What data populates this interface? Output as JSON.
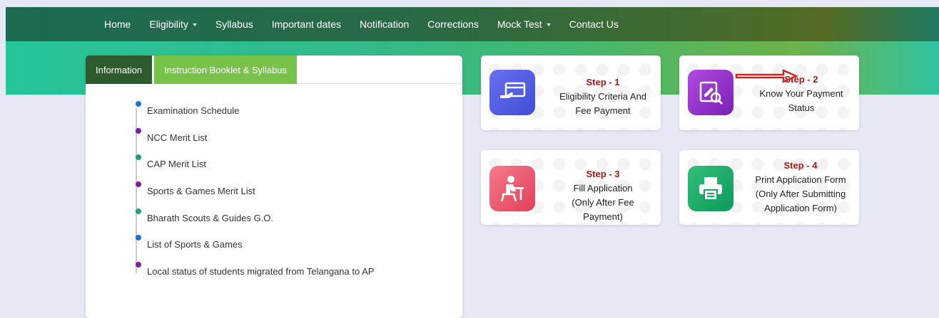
{
  "nav": {
    "home": "Home",
    "eligibility": "Eligibility",
    "syllabus": "Syllabus",
    "important_dates": "Important dates",
    "notification": "Notification",
    "corrections": "Corrections",
    "mock_test": "Mock Test",
    "contact_us": "Contact Us"
  },
  "tabs": {
    "information": "Information",
    "instruction": "Instruction Booklet & Syllabus"
  },
  "info_items": [
    {
      "label": "Examination Schedule",
      "color": "#1e6fd9"
    },
    {
      "label": "NCC Merit List",
      "color": "#7b1fa2"
    },
    {
      "label": "CAP Merit List",
      "color": "#1fa374"
    },
    {
      "label": "Sports & Games Merit List",
      "color": "#7b1fa2"
    },
    {
      "label": "Bharath Scouts & Guides G.O.",
      "color": "#1fa374"
    },
    {
      "label": "List of Sports & Games",
      "color": "#1e6fd9"
    },
    {
      "label": "Local status of students migrated from Telangana to AP",
      "color": "#7b1fa2"
    }
  ],
  "steps": {
    "s1": {
      "step": "Step - 1",
      "line1": "Eligibility Criteria And",
      "line2": "Fee Payment",
      "icon": "payment-card-icon"
    },
    "s2": {
      "step": "Step - 2",
      "line1": "Know Your Payment",
      "line2": "Status",
      "icon": "document-search-icon"
    },
    "s3": {
      "step": "Step - 3",
      "line1": "Fill Application",
      "line2": "(Only After Fee",
      "line3": "Payment)",
      "icon": "student-desk-icon"
    },
    "s4": {
      "step": "Step - 4",
      "line1": "Print Application Form",
      "line2": "(Only After Submitting",
      "line3": "Application Form)",
      "icon": "printer-icon"
    }
  },
  "colors": {
    "step_label": "#a61717",
    "arrow": "#c62828"
  }
}
